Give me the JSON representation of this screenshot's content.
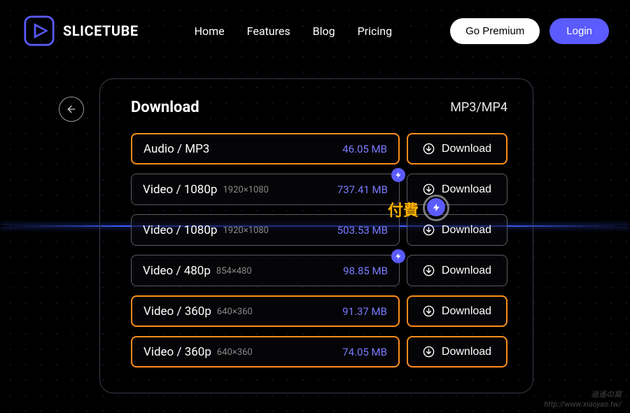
{
  "header": {
    "brand": "SLICETUBE",
    "nav": {
      "home": "Home",
      "features": "Features",
      "blog": "Blog",
      "pricing": "Pricing"
    },
    "premium": "Go Premium",
    "login": "Login"
  },
  "panel": {
    "title": "Download",
    "subtitle": "MP3/MP4",
    "download_label": "Download"
  },
  "rows": [
    {
      "format": "Audio / MP3",
      "resolution": "",
      "size": "46.05 MB",
      "highlight": true,
      "bolt": false
    },
    {
      "format": "Video / 1080p",
      "resolution": "1920×1080",
      "size": "737.41 MB",
      "highlight": false,
      "bolt": true
    },
    {
      "format": "Video / 1080p",
      "resolution": "1920×1080",
      "size": "503.53 MB",
      "highlight": false,
      "bolt": true
    },
    {
      "format": "Video / 480p",
      "resolution": "854×480",
      "size": "98.85 MB",
      "highlight": false,
      "bolt": true
    },
    {
      "format": "Video / 360p",
      "resolution": "640×360",
      "size": "91.37 MB",
      "highlight": true,
      "bolt": false
    },
    {
      "format": "Video / 360p",
      "resolution": "640×360",
      "size": "74.05 MB",
      "highlight": true,
      "bolt": false
    }
  ],
  "annotation": {
    "label": "付費"
  },
  "watermark": {
    "line1": "逍遙の窩",
    "line2": "http://www.xiaoyao.tw/"
  }
}
